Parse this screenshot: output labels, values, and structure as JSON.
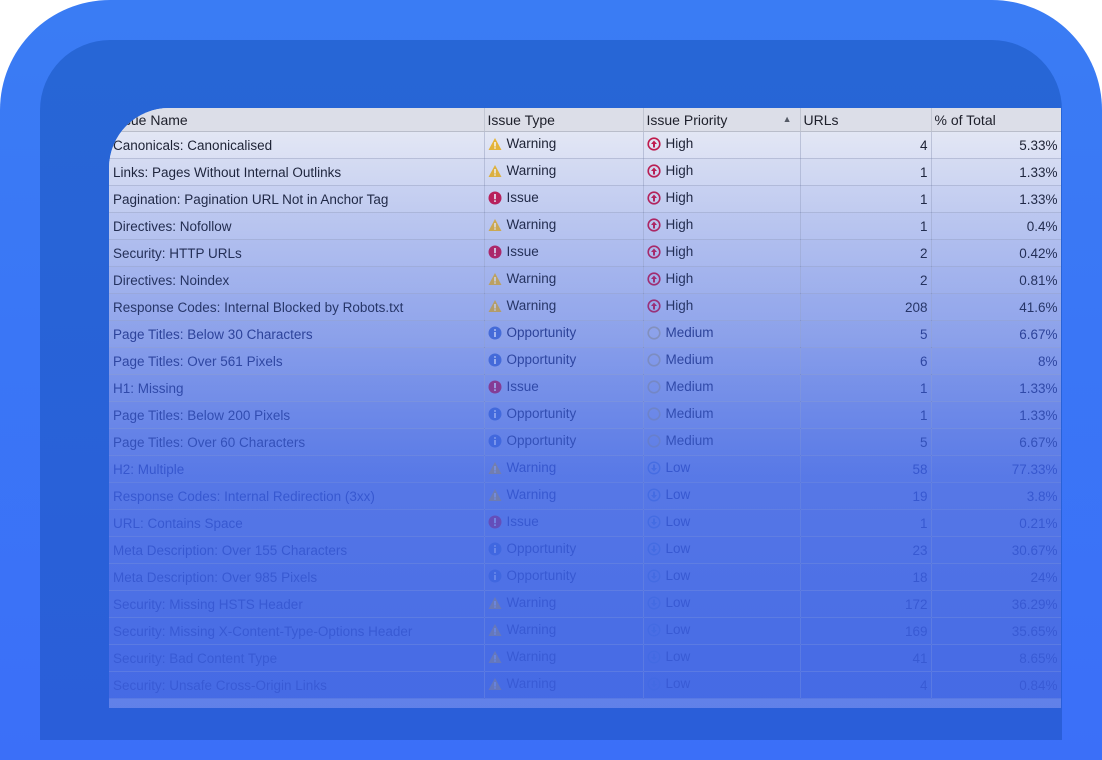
{
  "table": {
    "columns": [
      {
        "label": "Issue Name"
      },
      {
        "label": "Issue Type"
      },
      {
        "label": "Issue Priority",
        "sorted": "ascending"
      },
      {
        "label": "URLs"
      },
      {
        "label": "% of Total"
      }
    ],
    "rows": [
      {
        "name": "Canonicals: Canonicalised",
        "type": "Warning",
        "type_icon": "warning-icon",
        "priority": "High",
        "priority_icon": "priority-high-icon",
        "urls": "4",
        "percent": "5.33%"
      },
      {
        "name": "Links: Pages Without Internal Outlinks",
        "type": "Warning",
        "type_icon": "warning-icon",
        "priority": "High",
        "priority_icon": "priority-high-icon",
        "urls": "1",
        "percent": "1.33%"
      },
      {
        "name": "Pagination: Pagination URL Not in Anchor Tag",
        "type": "Issue",
        "type_icon": "issue-icon",
        "priority": "High",
        "priority_icon": "priority-high-icon",
        "urls": "1",
        "percent": "1.33%"
      },
      {
        "name": "Directives: Nofollow",
        "type": "Warning",
        "type_icon": "warning-icon",
        "priority": "High",
        "priority_icon": "priority-high-icon",
        "urls": "1",
        "percent": "0.4%"
      },
      {
        "name": "Security: HTTP URLs",
        "type": "Issue",
        "type_icon": "issue-icon",
        "priority": "High",
        "priority_icon": "priority-high-icon",
        "urls": "2",
        "percent": "0.42%"
      },
      {
        "name": "Directives: Noindex",
        "type": "Warning",
        "type_icon": "warning-icon",
        "priority": "High",
        "priority_icon": "priority-high-icon",
        "urls": "2",
        "percent": "0.81%"
      },
      {
        "name": "Response Codes: Internal Blocked by Robots.txt",
        "type": "Warning",
        "type_icon": "warning-icon",
        "priority": "High",
        "priority_icon": "priority-high-icon",
        "urls": "208",
        "percent": "41.6%"
      },
      {
        "name": "Page Titles: Below 30 Characters",
        "type": "Opportunity",
        "type_icon": "opportunity-icon",
        "priority": "Medium",
        "priority_icon": "priority-medium-icon",
        "urls": "5",
        "percent": "6.67%"
      },
      {
        "name": "Page Titles: Over 561 Pixels",
        "type": "Opportunity",
        "type_icon": "opportunity-icon",
        "priority": "Medium",
        "priority_icon": "priority-medium-icon",
        "urls": "6",
        "percent": "8%"
      },
      {
        "name": "H1: Missing",
        "type": "Issue",
        "type_icon": "issue-icon",
        "priority": "Medium",
        "priority_icon": "priority-medium-icon",
        "urls": "1",
        "percent": "1.33%"
      },
      {
        "name": "Page Titles: Below 200 Pixels",
        "type": "Opportunity",
        "type_icon": "opportunity-icon",
        "priority": "Medium",
        "priority_icon": "priority-medium-icon",
        "urls": "1",
        "percent": "1.33%"
      },
      {
        "name": "Page Titles: Over 60 Characters",
        "type": "Opportunity",
        "type_icon": "opportunity-icon",
        "priority": "Medium",
        "priority_icon": "priority-medium-icon",
        "urls": "5",
        "percent": "6.67%"
      },
      {
        "name": "H2: Multiple",
        "type": "Warning",
        "type_icon": "warning-icon",
        "priority": "Low",
        "priority_icon": "priority-low-icon",
        "urls": "58",
        "percent": "77.33%"
      },
      {
        "name": "Response Codes: Internal Redirection (3xx)",
        "type": "Warning",
        "type_icon": "warning-icon",
        "priority": "Low",
        "priority_icon": "priority-low-icon",
        "urls": "19",
        "percent": "3.8%"
      },
      {
        "name": "URL: Contains Space",
        "type": "Issue",
        "type_icon": "issue-icon",
        "priority": "Low",
        "priority_icon": "priority-low-icon",
        "urls": "1",
        "percent": "0.21%"
      },
      {
        "name": "Meta Description: Over 155 Characters",
        "type": "Opportunity",
        "type_icon": "opportunity-icon",
        "priority": "Low",
        "priority_icon": "priority-low-icon",
        "urls": "23",
        "percent": "30.67%"
      },
      {
        "name": "Meta Description: Over 985 Pixels",
        "type": "Opportunity",
        "type_icon": "opportunity-icon",
        "priority": "Low",
        "priority_icon": "priority-low-icon",
        "urls": "18",
        "percent": "24%"
      },
      {
        "name": "Security: Missing HSTS Header",
        "type": "Warning",
        "type_icon": "warning-icon",
        "priority": "Low",
        "priority_icon": "priority-low-icon",
        "urls": "172",
        "percent": "36.29%"
      },
      {
        "name": "Security: Missing X-Content-Type-Options Header",
        "type": "Warning",
        "type_icon": "warning-icon",
        "priority": "Low",
        "priority_icon": "priority-low-icon",
        "urls": "169",
        "percent": "35.65%"
      },
      {
        "name": "Security: Bad Content Type",
        "type": "Warning",
        "type_icon": "warning-icon",
        "priority": "Low",
        "priority_icon": "priority-low-icon",
        "urls": "41",
        "percent": "8.65%"
      },
      {
        "name": "Security: Unsafe Cross-Origin Links",
        "type": "Warning",
        "type_icon": "warning-icon",
        "priority": "Low",
        "priority_icon": "priority-low-icon",
        "urls": "4",
        "percent": "0.84%"
      }
    ]
  },
  "colors": {
    "outer_frame": "#3a7cf4",
    "inner_frame": "#2766d6",
    "warning": "#e8b634",
    "issue": "#c8184a",
    "opportunity": "#4a6fd0",
    "priority_high": "#c21a4a",
    "priority_medium": "#a8a8a8",
    "priority_low": "#5a7fd8"
  }
}
